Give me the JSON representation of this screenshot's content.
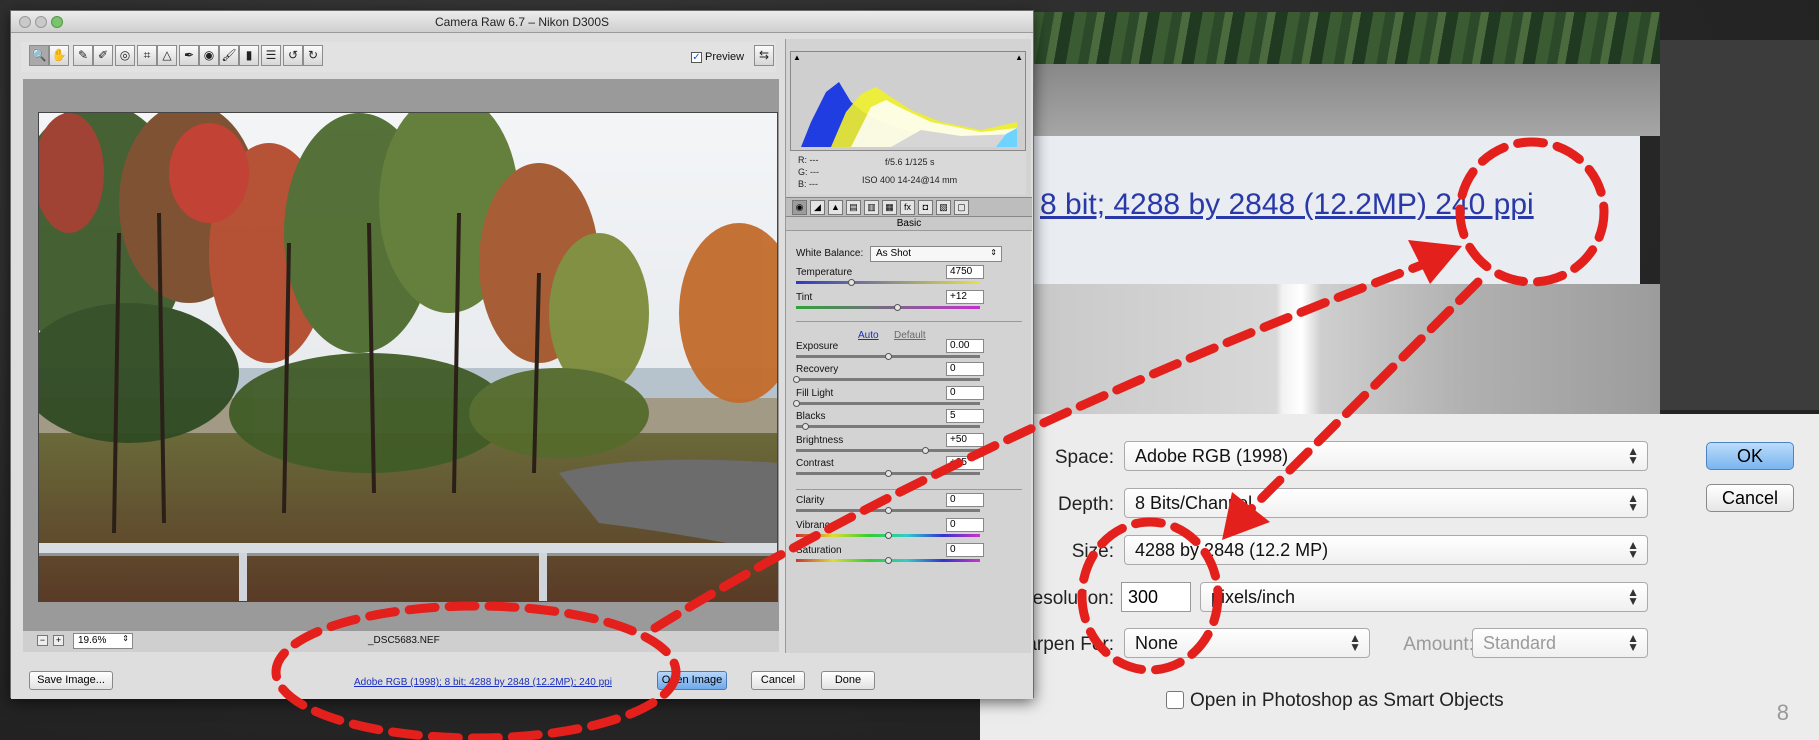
{
  "colors": {
    "annotation_red": "#e3201b",
    "link_blue": "#2a39a8",
    "ok_blue": "#79b5ef"
  },
  "zoom": {
    "info_text": "8 bit; 4288 by 2848 (12.2MP)  240 ppi",
    "fields": {
      "space_label": "Space:",
      "space_value": "Adobe RGB (1998)",
      "depth_label": "Depth:",
      "depth_value": "8 Bits/Channel",
      "size_label": "Size:",
      "size_value": "4288 by 2848  (12.2 MP)",
      "resolution_label": "Resolution:",
      "resolution_value": "300",
      "resolution_unit": "pixels/inch",
      "sharpen_label": "Sharpen For:",
      "sharpen_value": "None",
      "amount_label": "Amount:",
      "amount_value": "Standard"
    },
    "ok_label": "OK",
    "cancel_label": "Cancel",
    "smart_objects_label": "Open in Photoshop as Smart Objects"
  },
  "slide_number": "8",
  "camera_raw": {
    "title": "Camera Raw 6.7  –  Nikon D300S",
    "preview_label": "Preview",
    "preview_checked": true,
    "zoom_level": "19.6%",
    "filename": "_DSC5683.NEF",
    "buttons": {
      "save": "Save Image...",
      "open": "Open Image",
      "cancel": "Cancel",
      "done": "Done"
    },
    "workflow_link": "Adobe RGB (1998); 8 bit; 4288 by 2848 (12.2MP); 240 ppi",
    "tools": [
      {
        "icon": "zoom-icon",
        "glyph": "🔍"
      },
      {
        "icon": "hand-icon",
        "glyph": "✋"
      },
      {
        "icon": "white-balance-icon",
        "glyph": "✎"
      },
      {
        "icon": "color-sampler-icon",
        "glyph": "✐"
      },
      {
        "icon": "target-adjust-icon",
        "glyph": "◎"
      },
      {
        "icon": "crop-icon",
        "glyph": "⌗"
      },
      {
        "icon": "straighten-icon",
        "glyph": "△"
      },
      {
        "icon": "spot-removal-icon",
        "glyph": "✒"
      },
      {
        "icon": "red-eye-icon",
        "glyph": "◉"
      },
      {
        "icon": "adjustment-brush-icon",
        "glyph": "🖌"
      },
      {
        "icon": "graduated-filter-icon",
        "glyph": "▮"
      },
      {
        "icon": "preferences-icon",
        "glyph": "☰"
      },
      {
        "icon": "rotate-left-icon",
        "glyph": "↺"
      },
      {
        "icon": "rotate-right-icon",
        "glyph": "↻"
      }
    ],
    "metadata": {
      "r": "R:  ---",
      "g": "G:  ---",
      "b": "B:  ---",
      "aperture_shutter": "f/5.6   1/125 s",
      "iso_lens": "ISO 400    14-24@14 mm"
    },
    "panel_title": "Basic",
    "white_balance_label": "White Balance:",
    "white_balance_value": "As Shot",
    "auto_label": "Auto",
    "default_label": "Default",
    "sliders": [
      {
        "label": "Temperature",
        "value": "4750",
        "pos": 0.3
      },
      {
        "label": "Tint",
        "value": "+12",
        "pos": 0.55
      },
      {
        "label": "Exposure",
        "value": "0.00",
        "pos": 0.5
      },
      {
        "label": "Recovery",
        "value": "0",
        "pos": 0.0
      },
      {
        "label": "Fill Light",
        "value": "0",
        "pos": 0.0
      },
      {
        "label": "Blacks",
        "value": "5",
        "pos": 0.05
      },
      {
        "label": "Brightness",
        "value": "+50",
        "pos": 0.7
      },
      {
        "label": "Contrast",
        "value": "+25",
        "pos": 0.5
      },
      {
        "label": "Clarity",
        "value": "0",
        "pos": 0.5
      },
      {
        "label": "Vibrance",
        "value": "0",
        "pos": 0.5
      },
      {
        "label": "Saturation",
        "value": "0",
        "pos": 0.5
      }
    ]
  }
}
